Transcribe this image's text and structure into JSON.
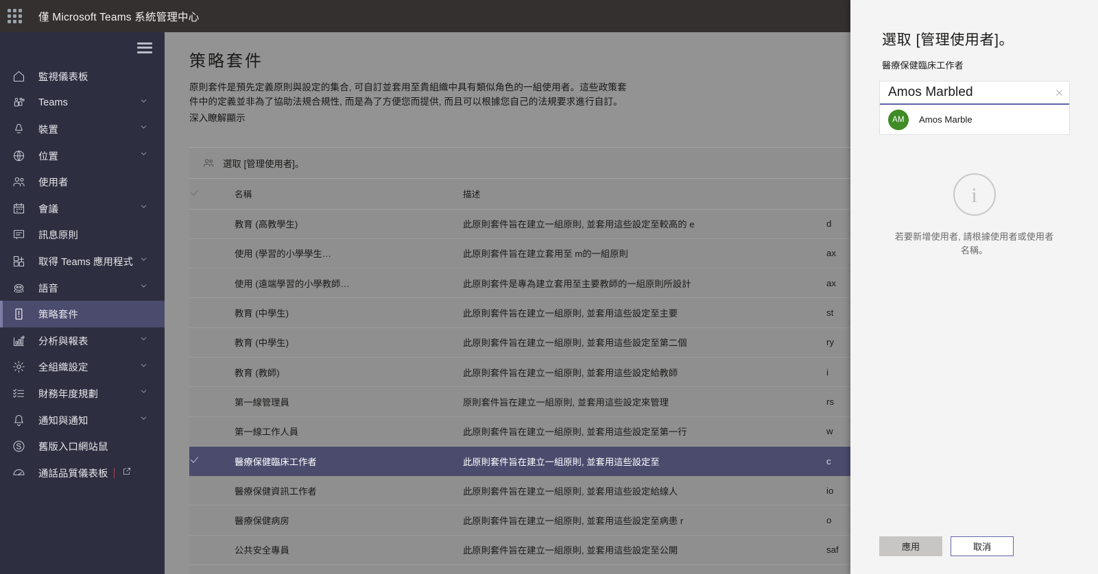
{
  "suite": {
    "title": "僅 Microsoft Teams 系統管理中心",
    "waffle_icon": "waffle-grid-icon"
  },
  "sidebar": {
    "menu_icon": "hamburger-icon",
    "items": [
      {
        "label": "監視儀表板",
        "icon": "home-icon",
        "expandable": false,
        "active": false
      },
      {
        "label": "Teams",
        "icon": "teams-icon",
        "expandable": true,
        "active": false
      },
      {
        "label": "裝置",
        "icon": "device-icon",
        "expandable": true,
        "active": false
      },
      {
        "label": "位置",
        "icon": "globe-icon",
        "expandable": true,
        "active": false
      },
      {
        "label": "使用者",
        "icon": "people-icon",
        "expandable": false,
        "active": false
      },
      {
        "label": "會議",
        "icon": "calendar-icon",
        "expandable": true,
        "active": false
      },
      {
        "label": "訊息原則",
        "icon": "chat-icon",
        "expandable": false,
        "active": false
      },
      {
        "label": "取得 Teams 應用程式",
        "icon": "apps-icon",
        "expandable": true,
        "active": false
      },
      {
        "label": "語音",
        "icon": "phone-icon",
        "expandable": true,
        "active": false
      },
      {
        "label": "策略套件",
        "icon": "policy-icon",
        "expandable": false,
        "active": true
      },
      {
        "label": "分析與報表",
        "icon": "chart-icon",
        "expandable": true,
        "active": false
      },
      {
        "label": "全組織設定",
        "icon": "gear-icon",
        "expandable": true,
        "active": false
      },
      {
        "label": "財務年度規劃",
        "icon": "checklist-icon",
        "expandable": true,
        "active": false
      },
      {
        "label": "通知與通知",
        "icon": "bell-icon",
        "expandable": true,
        "active": false
      },
      {
        "label": "舊版入口網站鼠",
        "icon": "skype-icon",
        "expandable": false,
        "active": false
      },
      {
        "label": "通話品質儀表板",
        "icon": "gauge-icon",
        "expandable": false,
        "active": false,
        "external": true
      }
    ]
  },
  "page": {
    "title": "策略套件",
    "description": "原則套件是預先定義原則與設定的集合, 可自訂並套用至貴組織中具有類似角色的一組使用者。這些政策套件中的定義並非為了協助法規合規性, 而是為了方便您而提供, 而且可以根據您自己的法規要求進行自訂。",
    "learn_more": "深入瞭解顯示"
  },
  "toolbar": {
    "manage_users_label": "選取 [管理使用者]。",
    "manage_users_icon": "people-icon"
  },
  "table": {
    "headers": {
      "select": "",
      "name": "名稱",
      "description": "描述",
      "extra": ""
    },
    "select_all_icon": "checkmark-icon",
    "rows": [
      {
        "name": "教育 (高教學生)",
        "description": "此原則套件旨在建立一組原則, 並套用這些設定至較高的 e",
        "extra": "d",
        "selected": false
      },
      {
        "name": "使用 (學習的小學學生…",
        "description": "此原則套件旨在建立套用至 m的一組原則",
        "extra": "ax",
        "selected": false
      },
      {
        "name": "使用 (遠端學習的小學教師…",
        "description": "此原則套件是專為建立套用至主要教師的一組原則所設計",
        "extra": "ax",
        "selected": false
      },
      {
        "name": "教育 (中學生)",
        "description": "此原則套件旨在建立一組原則, 並套用這些設定至主要",
        "extra": "st",
        "selected": false
      },
      {
        "name": "教育 (中學生)",
        "description": "此原則套件旨在建立一組原則, 並套用這些設定至第二個",
        "extra": "ry",
        "selected": false
      },
      {
        "name": "教育 (教師)",
        "description": "此原則套件旨在建立一組原則, 並套用這些設定給教師",
        "extra": "i",
        "selected": false
      },
      {
        "name": "第一線管理員",
        "description": "原則套件旨在建立一組原則, 並套用這些設定來管理",
        "extra": "rs",
        "selected": false
      },
      {
        "name": "第一線工作人員",
        "description": "此原則套件旨在建立一組原則, 並套用這些設定至第一行",
        "extra": "w",
        "selected": false
      },
      {
        "name": "醫療保健臨床工作者",
        "description": "此原則套件旨在建立一組原則, 並套用這些設定至",
        "extra": "c",
        "selected": true
      },
      {
        "name": "醫療保健資訊工作者",
        "description": "此原則套件旨在建立一組原則, 並套用這些設定給線人",
        "extra": "io",
        "selected": false
      },
      {
        "name": "醫療保健病房",
        "description": "此原則套件旨在建立一組原則, 並套用這些設定至病患 r",
        "extra": "o",
        "selected": false
      },
      {
        "name": "公共安全專員",
        "description": "此原則套件旨在建立一組原則, 並套用這些設定至公開",
        "extra": "saf",
        "selected": false
      }
    ]
  },
  "panel": {
    "title": "選取 [管理使用者]。",
    "subtitle": "醫療保健臨床工作者",
    "search": {
      "value": "Amos Marbled",
      "placeholder": "",
      "clear_icon": "close-icon"
    },
    "suggestions": [
      {
        "initials": "AM",
        "name": "Amos Marble",
        "avatar_color": "#3f8b25"
      }
    ],
    "empty_state": {
      "icon": "info-icon",
      "glyph": "i",
      "message": "若要新增使用者, 請根據使用者或使用者名稱。"
    },
    "actions": {
      "apply_label": "應用",
      "cancel_label": "取消"
    }
  },
  "colors": {
    "suite_bar": "#33302f",
    "sidenav": "#2d2e3f",
    "accent": "#6264a7",
    "selected_row": "#4b4b6e",
    "avatar_green": "#3f8b25",
    "panel_bg": "#f4f4f4"
  }
}
